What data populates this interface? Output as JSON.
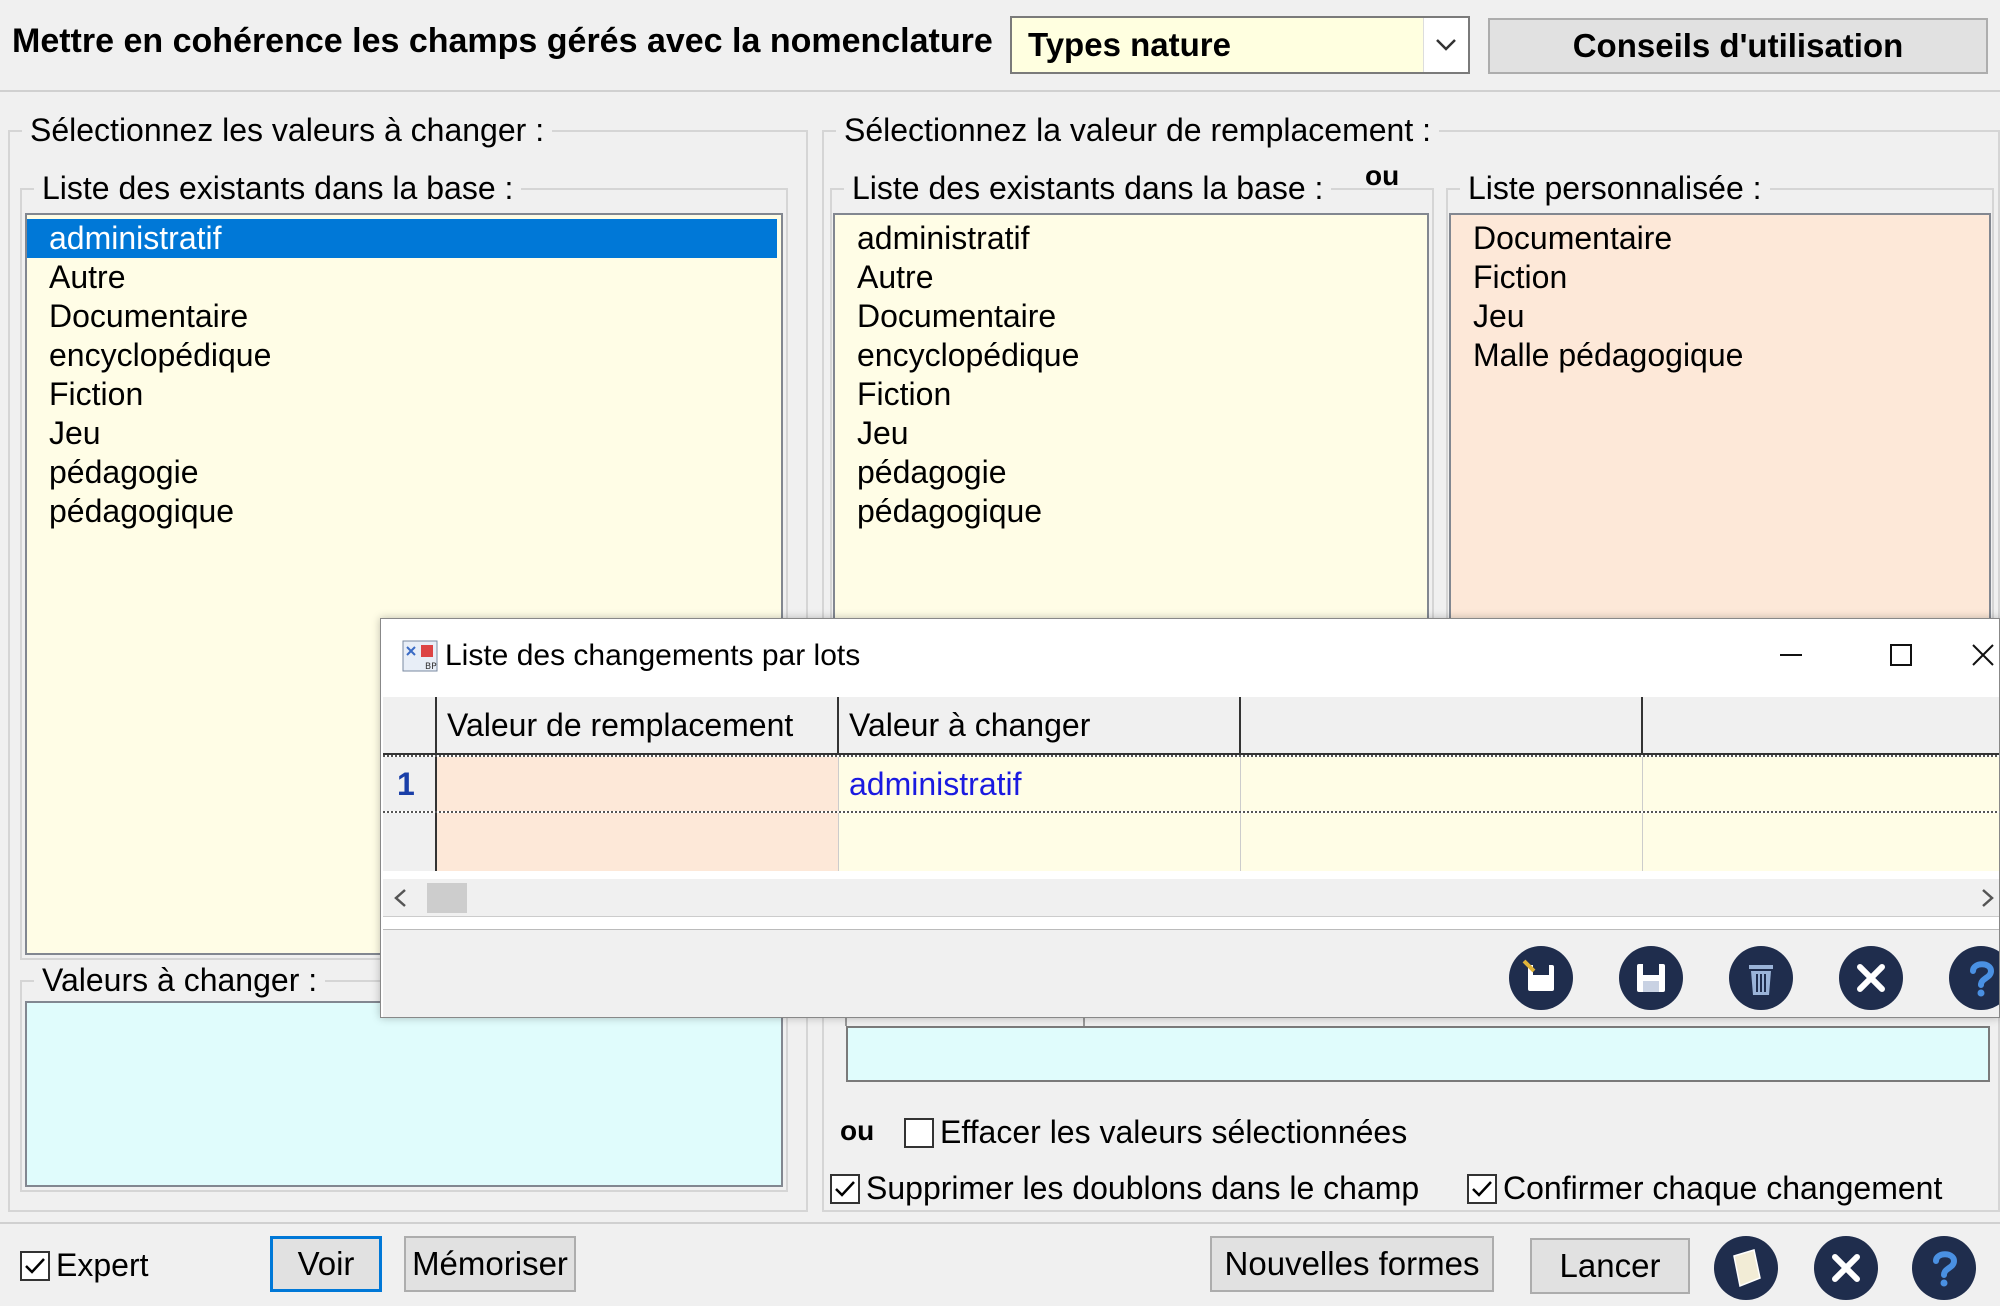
{
  "header": {
    "title": "Mettre en cohérence les champs gérés avec la nomenclature",
    "combo_value": "Types nature",
    "advice_button": "Conseils d'utilisation"
  },
  "left_group": {
    "legend": "Sélectionnez les valeurs à changer :",
    "list_legend": "Liste des existants dans la base :",
    "items": [
      "administratif",
      "Autre",
      "Documentaire",
      "encyclopédique",
      "Fiction",
      "Jeu",
      "pédagogie",
      "pédagogique"
    ],
    "selected_index": 0,
    "values_legend": "Valeurs à changer :"
  },
  "right_group": {
    "legend": "Sélectionnez la valeur de remplacement :",
    "ou_label": "ou",
    "list_legend": "Liste des existants dans la base :",
    "items": [
      "administratif",
      "Autre",
      "Documentaire",
      "encyclopédique",
      "Fiction",
      "Jeu",
      "pédagogie",
      "pédagogique"
    ],
    "custom_legend": "Liste personnalisée :",
    "custom_items": [
      "Documentaire",
      "Fiction",
      "Jeu",
      "Malle pédagogique"
    ]
  },
  "options": {
    "ou_label": "ou",
    "erase_label": "Effacer les valeurs sélectionnées",
    "erase_checked": false,
    "dedupe_label": "Supprimer les doublons dans le champ",
    "dedupe_checked": true,
    "confirm_label": "Confirmer chaque changement",
    "confirm_checked": true
  },
  "footer": {
    "expert_label": "Expert",
    "expert_checked": true,
    "voir": "Voir",
    "memoriser": "Mémoriser",
    "nouvelles_formes": "Nouvelles formes",
    "lancer": "Lancer"
  },
  "dialog": {
    "title": "Liste des changements par lots",
    "columns": [
      "Valeur de remplacement",
      "Valeur à changer",
      "",
      ""
    ],
    "rows": [
      {
        "num": "1",
        "replacement": "",
        "value": "administratif"
      },
      {
        "num": "",
        "replacement": "",
        "value": ""
      }
    ]
  },
  "colors": {
    "selection": "#0078d7",
    "list_yellow": "#fffde6",
    "list_peach": "#fde8d8",
    "list_cyan": "#e0fcfc",
    "icon_navy": "#1f2d4d"
  }
}
